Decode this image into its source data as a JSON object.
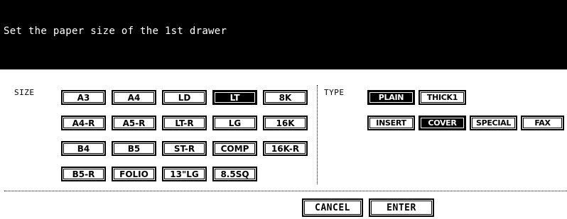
{
  "message": "Set the paper size of the 1st drawer",
  "size_section": {
    "label": "SIZE",
    "options": [
      "A3",
      "A4",
      "LD",
      "LT",
      "8K",
      "A4-R",
      "A5-R",
      "LT-R",
      "LG",
      "16K",
      "B4",
      "B5",
      "ST-R",
      "COMP",
      "16K-R",
      "B5-R",
      "FOLIO",
      "13\"LG",
      "8.5SQ"
    ],
    "selected": "LT"
  },
  "type_section": {
    "label": "TYPE",
    "options": [
      "PLAIN",
      "THICK1",
      "INSERT",
      "COVER",
      "SPECIAL",
      "FAX"
    ],
    "selected": [
      "PLAIN",
      "COVER"
    ]
  },
  "footer": {
    "cancel_label": "CANCEL",
    "enter_label": "ENTER"
  }
}
